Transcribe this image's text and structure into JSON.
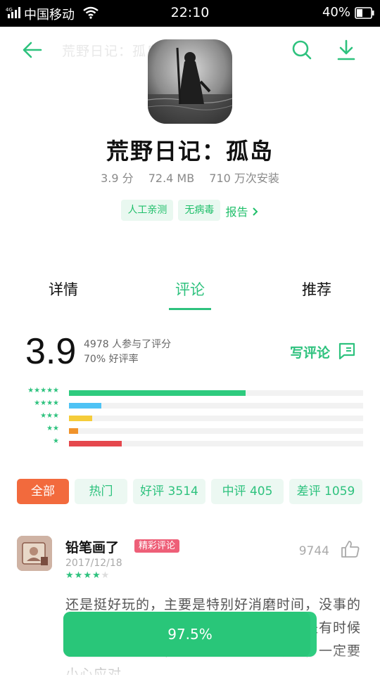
{
  "status_bar": {
    "network": "4G",
    "carrier": "中国移动",
    "time": "22:10",
    "battery": "40%"
  },
  "nav": {
    "title": "荒野日记：孤岛"
  },
  "app": {
    "name": "荒野日记：孤岛",
    "rating": "3.9 分",
    "size": "72.4 MB",
    "installs": "710 万次安装",
    "tags": [
      "人工亲测",
      "无病毒"
    ],
    "report_label": "报告"
  },
  "tabs": [
    {
      "label": "详情",
      "active": false
    },
    {
      "label": "评论",
      "active": true
    },
    {
      "label": "推荐",
      "active": false
    }
  ],
  "rating_summary": {
    "score": "3.9",
    "participants": "4978 人参与了评分",
    "good_rate": "70% 好评率",
    "write_review": "写评论",
    "distribution": [
      {
        "stars": 5,
        "fraction": 0.6,
        "color": "#2ecb7e"
      },
      {
        "stars": 4,
        "fraction": 0.11,
        "color": "#4ec3f5"
      },
      {
        "stars": 3,
        "fraction": 0.08,
        "color": "#f5cc3a"
      },
      {
        "stars": 2,
        "fraction": 0.03,
        "color": "#f0932b"
      },
      {
        "stars": 1,
        "fraction": 0.18,
        "color": "#e5484d"
      }
    ]
  },
  "filters": [
    {
      "label": "全部",
      "active": true
    },
    {
      "label": "热门",
      "active": false
    },
    {
      "label": "好评 3514",
      "active": false
    },
    {
      "label": "中评 405",
      "active": false
    },
    {
      "label": "差评 1059",
      "active": false
    }
  ],
  "review": {
    "user": "铅笔画了",
    "badge": "精彩评论",
    "date": "2017/12/18",
    "stars": 4,
    "likes": "9744",
    "text": "还是挺好玩的，主要是特别好消磨时间，没事的时候可以玩一玩，打发时间挺好的，但是有时候会遇到一些危险，比如外面野兽和敌人，一定要小心应对。"
  },
  "install_button": {
    "label": "97.5%",
    "progress": 0.975
  },
  "colors": {
    "accent": "#2ec27e",
    "active_filter": "#f26a3d",
    "badge": "#ee5f78"
  }
}
